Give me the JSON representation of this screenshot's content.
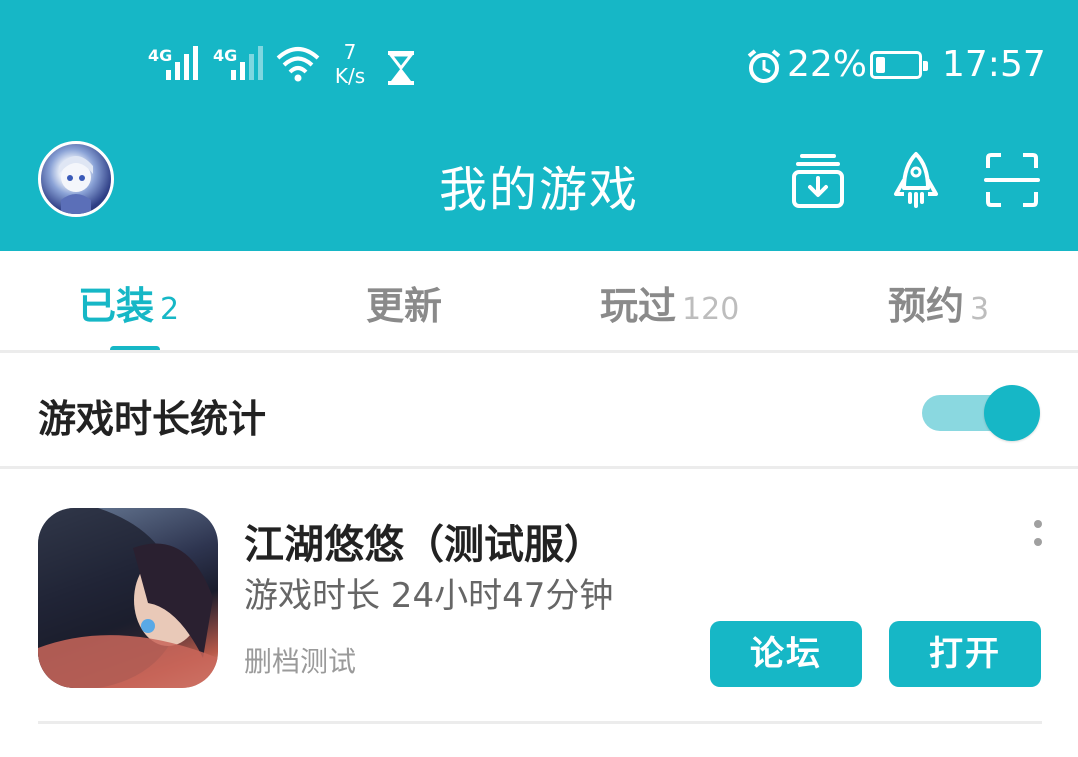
{
  "status_bar": {
    "signal_1": "4G",
    "signal_2": "4G",
    "speed_value": "7",
    "speed_unit": "K/s",
    "battery_percent": "22%",
    "battery_level": 0.22,
    "time": "17:57"
  },
  "app_bar": {
    "title": "我的游戏",
    "icons": [
      "download-box-icon",
      "rocket-icon",
      "scan-icon"
    ]
  },
  "tabs": [
    {
      "label": "已装",
      "count": "2",
      "active": true
    },
    {
      "label": "更新",
      "count": "",
      "active": false
    },
    {
      "label": "玩过",
      "count": "120",
      "active": false
    },
    {
      "label": "预约",
      "count": "3",
      "active": false
    }
  ],
  "stats": {
    "label": "游戏时长统计",
    "enabled": true
  },
  "games": [
    {
      "title": "江湖悠悠（测试服）",
      "playtime": "游戏时长 24小时47分钟",
      "tag": "删档测试",
      "forum_label": "论坛",
      "open_label": "打开"
    }
  ],
  "colors": {
    "accent": "#16b7c6",
    "accent_light": "#8ad8e0",
    "divider": "#ececec"
  }
}
